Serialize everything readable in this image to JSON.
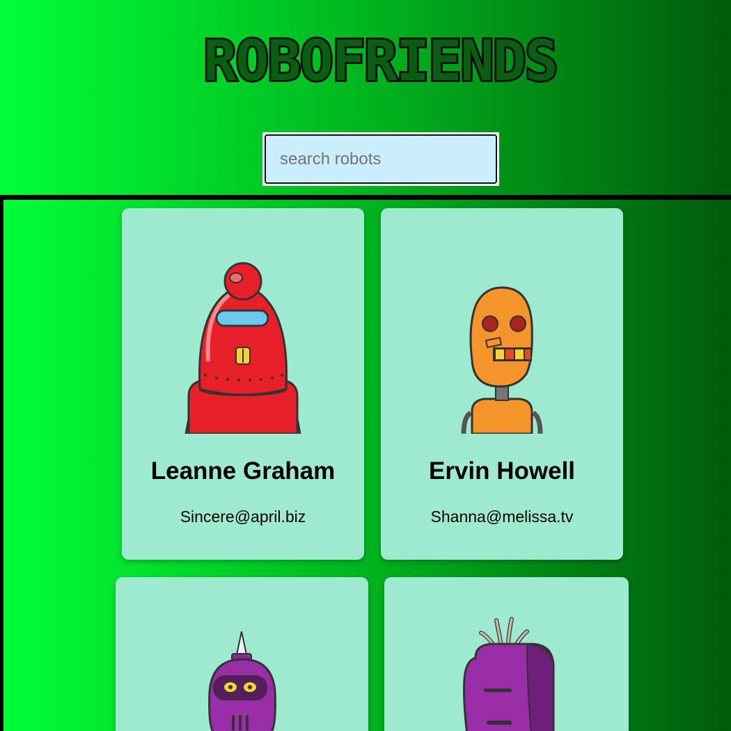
{
  "app": {
    "title": "ROBOFRIENDS"
  },
  "search": {
    "placeholder": "search robots",
    "value": ""
  },
  "robots": [
    {
      "name": "Leanne Graham",
      "email": "Sincere@april.biz",
      "avatar": "red-robot-icon"
    },
    {
      "name": "Ervin Howell",
      "email": "Shanna@melissa.tv",
      "avatar": "orange-robot-icon"
    },
    {
      "name": "",
      "email": "",
      "avatar": "purple-horn-robot-icon"
    },
    {
      "name": "",
      "email": "",
      "avatar": "purple-tuft-robot-icon"
    }
  ],
  "colors": {
    "card": "#9eead0",
    "search_bg": "#cbeefc",
    "gradient_start": "#00ff37",
    "gradient_end": "#005a0b"
  }
}
